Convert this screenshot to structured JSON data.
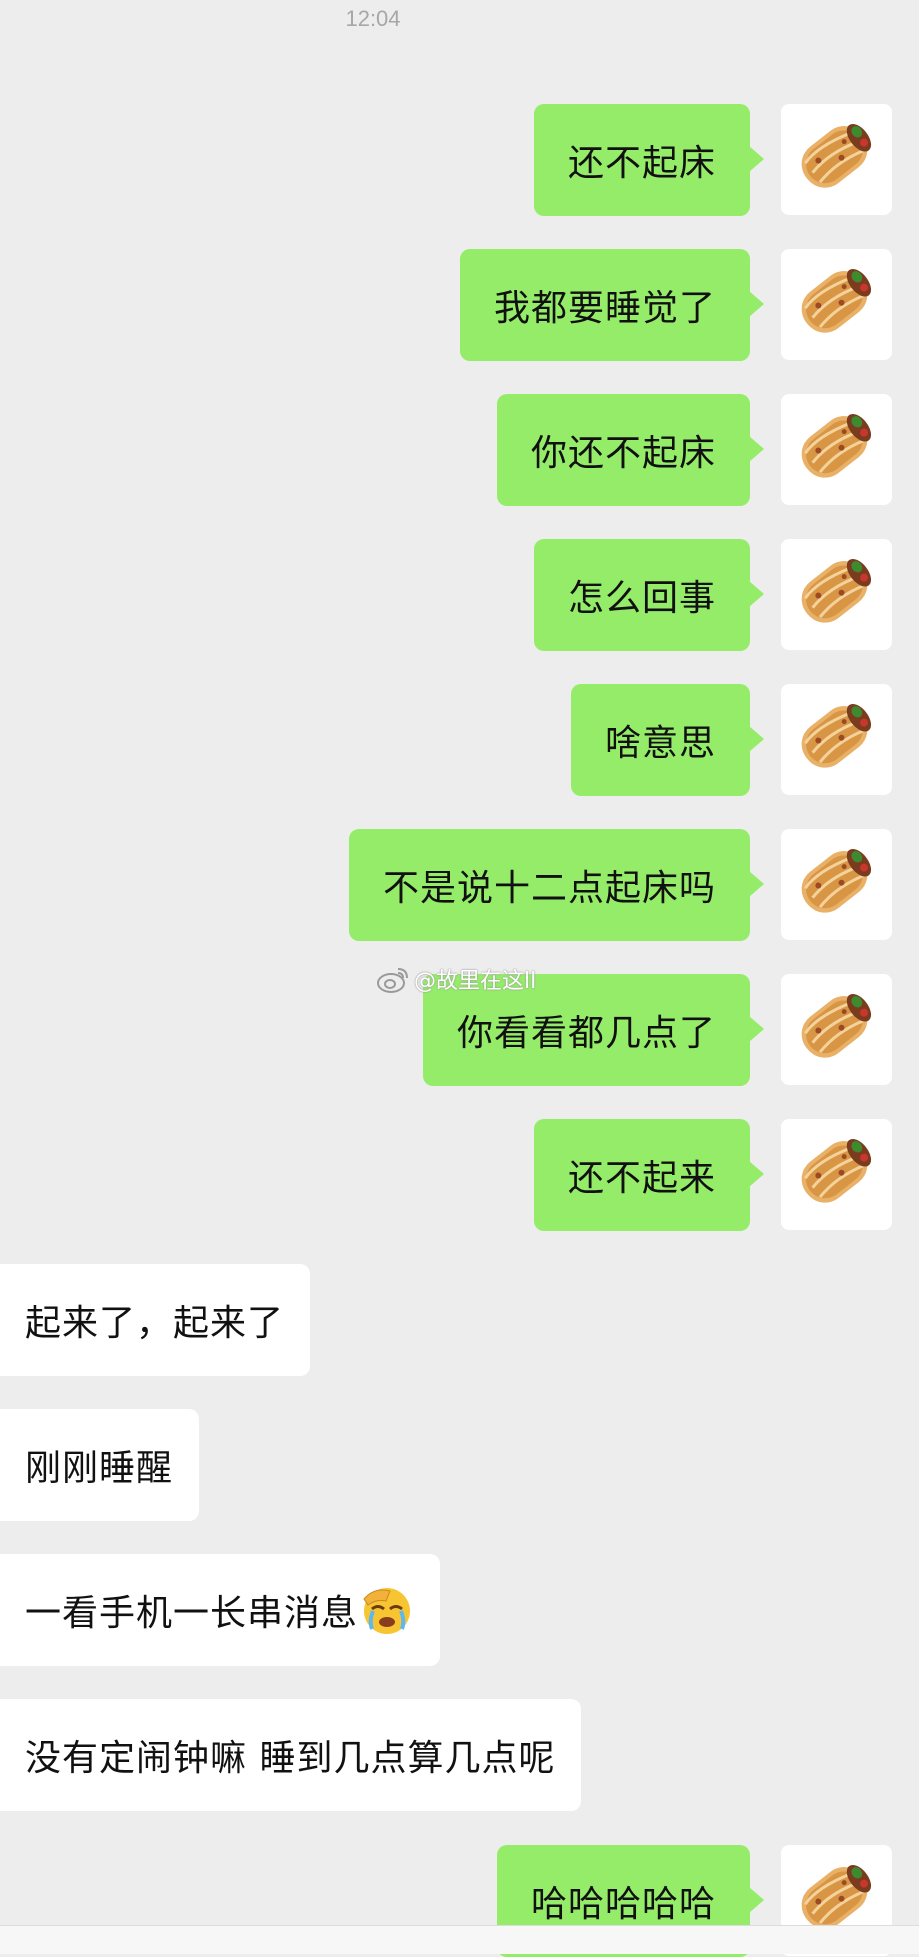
{
  "status": {
    "time": "12:04"
  },
  "watermark": {
    "handle": "@故里在这ll",
    "icon": "weibo-icon"
  },
  "messages": [
    {
      "side": "me",
      "text": "还不起床",
      "avatar": "burrito-avatar"
    },
    {
      "side": "me",
      "text": "我都要睡觉了",
      "avatar": "burrito-avatar"
    },
    {
      "side": "me",
      "text": "你还不起床",
      "avatar": "burrito-avatar"
    },
    {
      "side": "me",
      "text": "怎么回事",
      "avatar": "burrito-avatar"
    },
    {
      "side": "me",
      "text": "啥意思",
      "avatar": "burrito-avatar"
    },
    {
      "side": "me",
      "text": "不是说十二点起床吗",
      "avatar": "burrito-avatar"
    },
    {
      "side": "me",
      "text": "你看看都几点了",
      "avatar": "burrito-avatar"
    },
    {
      "side": "me",
      "text": "还不起来",
      "avatar": "burrito-avatar"
    },
    {
      "side": "them",
      "text": "起来了，起来了"
    },
    {
      "side": "them",
      "text": "刚刚睡醒"
    },
    {
      "side": "them",
      "text": "一看手机一长串消息",
      "emoji": "face-palm-crying-emoji"
    },
    {
      "side": "them",
      "text": "没有定闹钟嘛 睡到几点算几点呢"
    },
    {
      "side": "me",
      "text": "哈哈哈哈哈",
      "avatar": "burrito-avatar"
    }
  ],
  "colors": {
    "background": "#ededed",
    "me_bubble": "#95ec69",
    "them_bubble": "#ffffff"
  }
}
